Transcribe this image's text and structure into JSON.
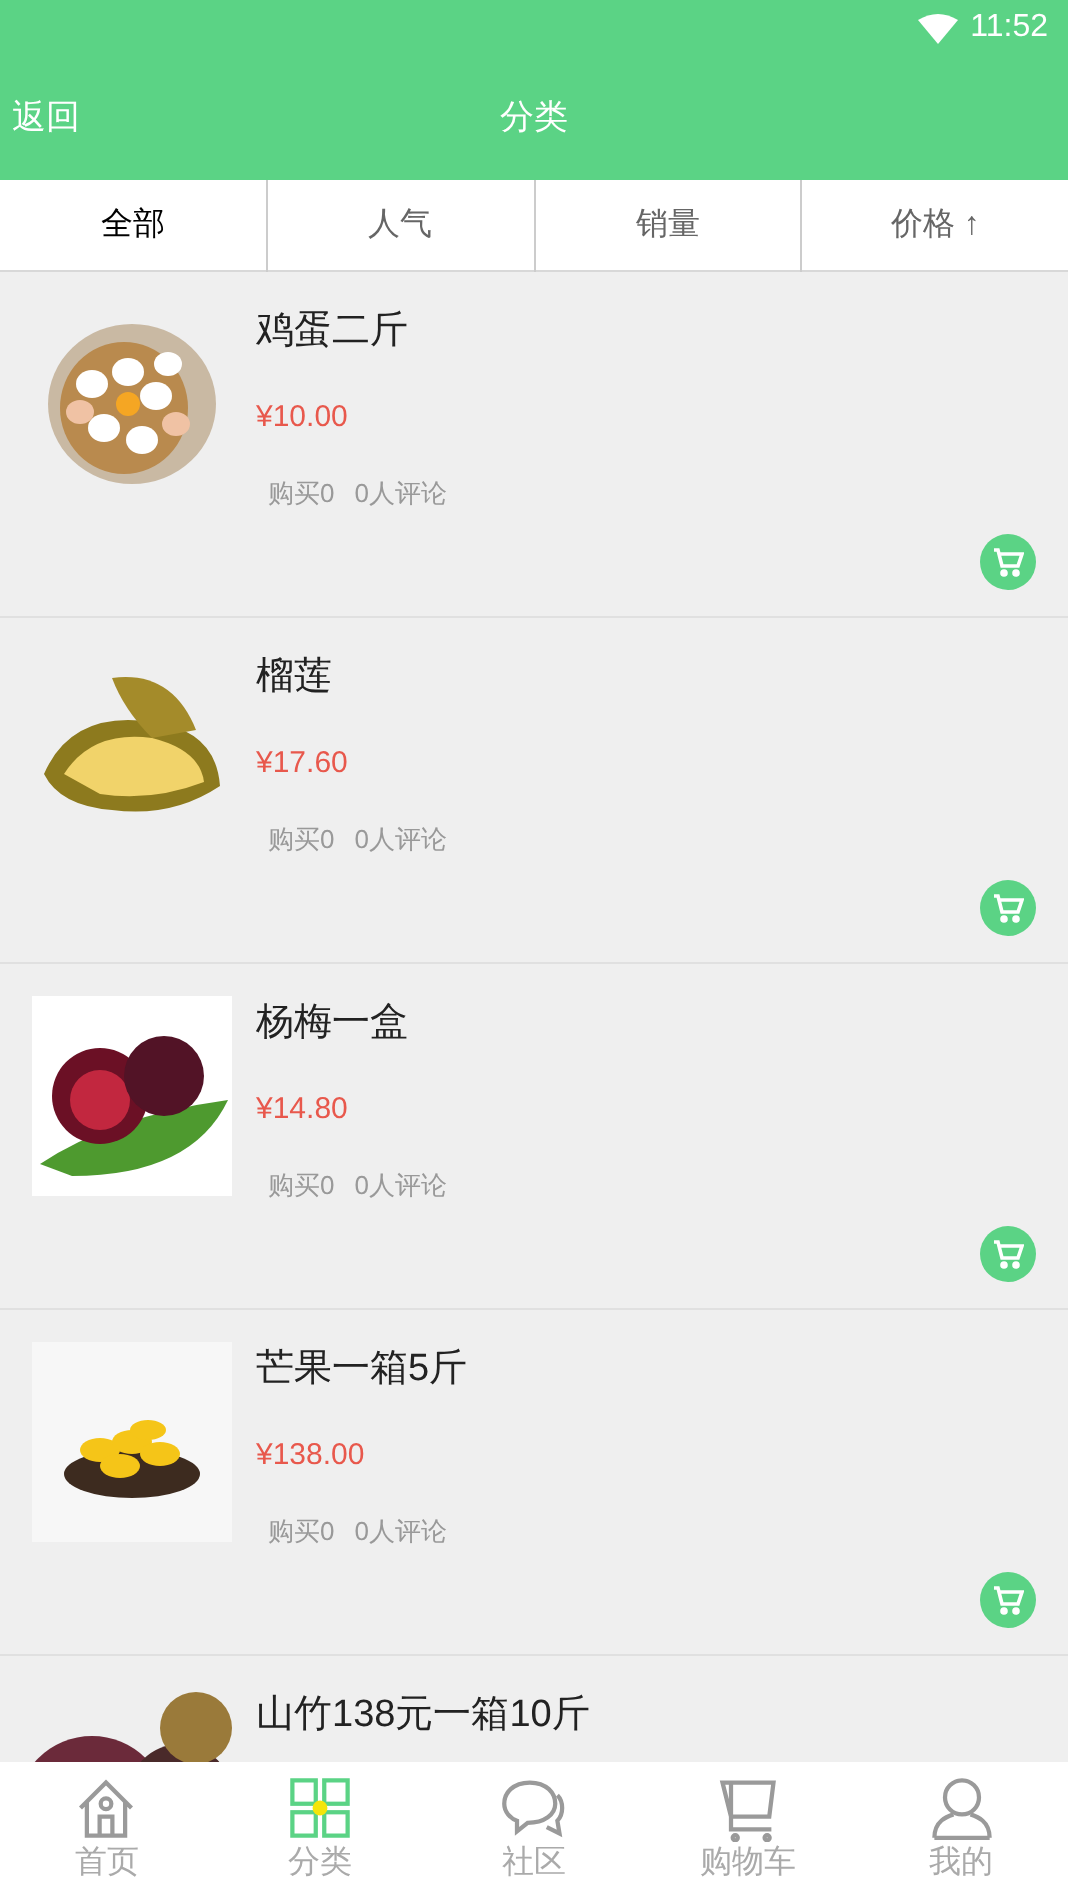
{
  "status_bar": {
    "time": "11:52"
  },
  "header": {
    "back": "返回",
    "title": "分类"
  },
  "tabs": [
    {
      "label": "全部",
      "selected": true
    },
    {
      "label": "人气",
      "selected": false
    },
    {
      "label": "销量",
      "selected": false
    },
    {
      "label": "价格 ↑",
      "selected": false
    }
  ],
  "products": [
    {
      "kind": "eggs",
      "name": "鸡蛋二斤",
      "price": "¥10.00",
      "purchases": "购买0",
      "reviews": "0人评论"
    },
    {
      "kind": "durian",
      "name": "榴莲",
      "price": "¥17.60",
      "purchases": "购买0",
      "reviews": "0人评论"
    },
    {
      "kind": "bayberry",
      "name": "杨梅一盒",
      "price": "¥14.80",
      "purchases": "购买0",
      "reviews": "0人评论"
    },
    {
      "kind": "mango",
      "name": "芒果一箱5斤",
      "price": "¥138.00",
      "purchases": "购买0",
      "reviews": "0人评论"
    },
    {
      "kind": "mangosteen",
      "name": "山竹138元一箱10斤"
    }
  ],
  "bottom_nav": [
    {
      "kind": "home",
      "label": "首页",
      "selected": false
    },
    {
      "kind": "category",
      "label": "分类",
      "selected": true
    },
    {
      "kind": "community",
      "label": "社区",
      "selected": false
    },
    {
      "kind": "cart",
      "label": "购物车",
      "selected": false
    },
    {
      "kind": "profile",
      "label": "我的",
      "selected": false
    }
  ]
}
